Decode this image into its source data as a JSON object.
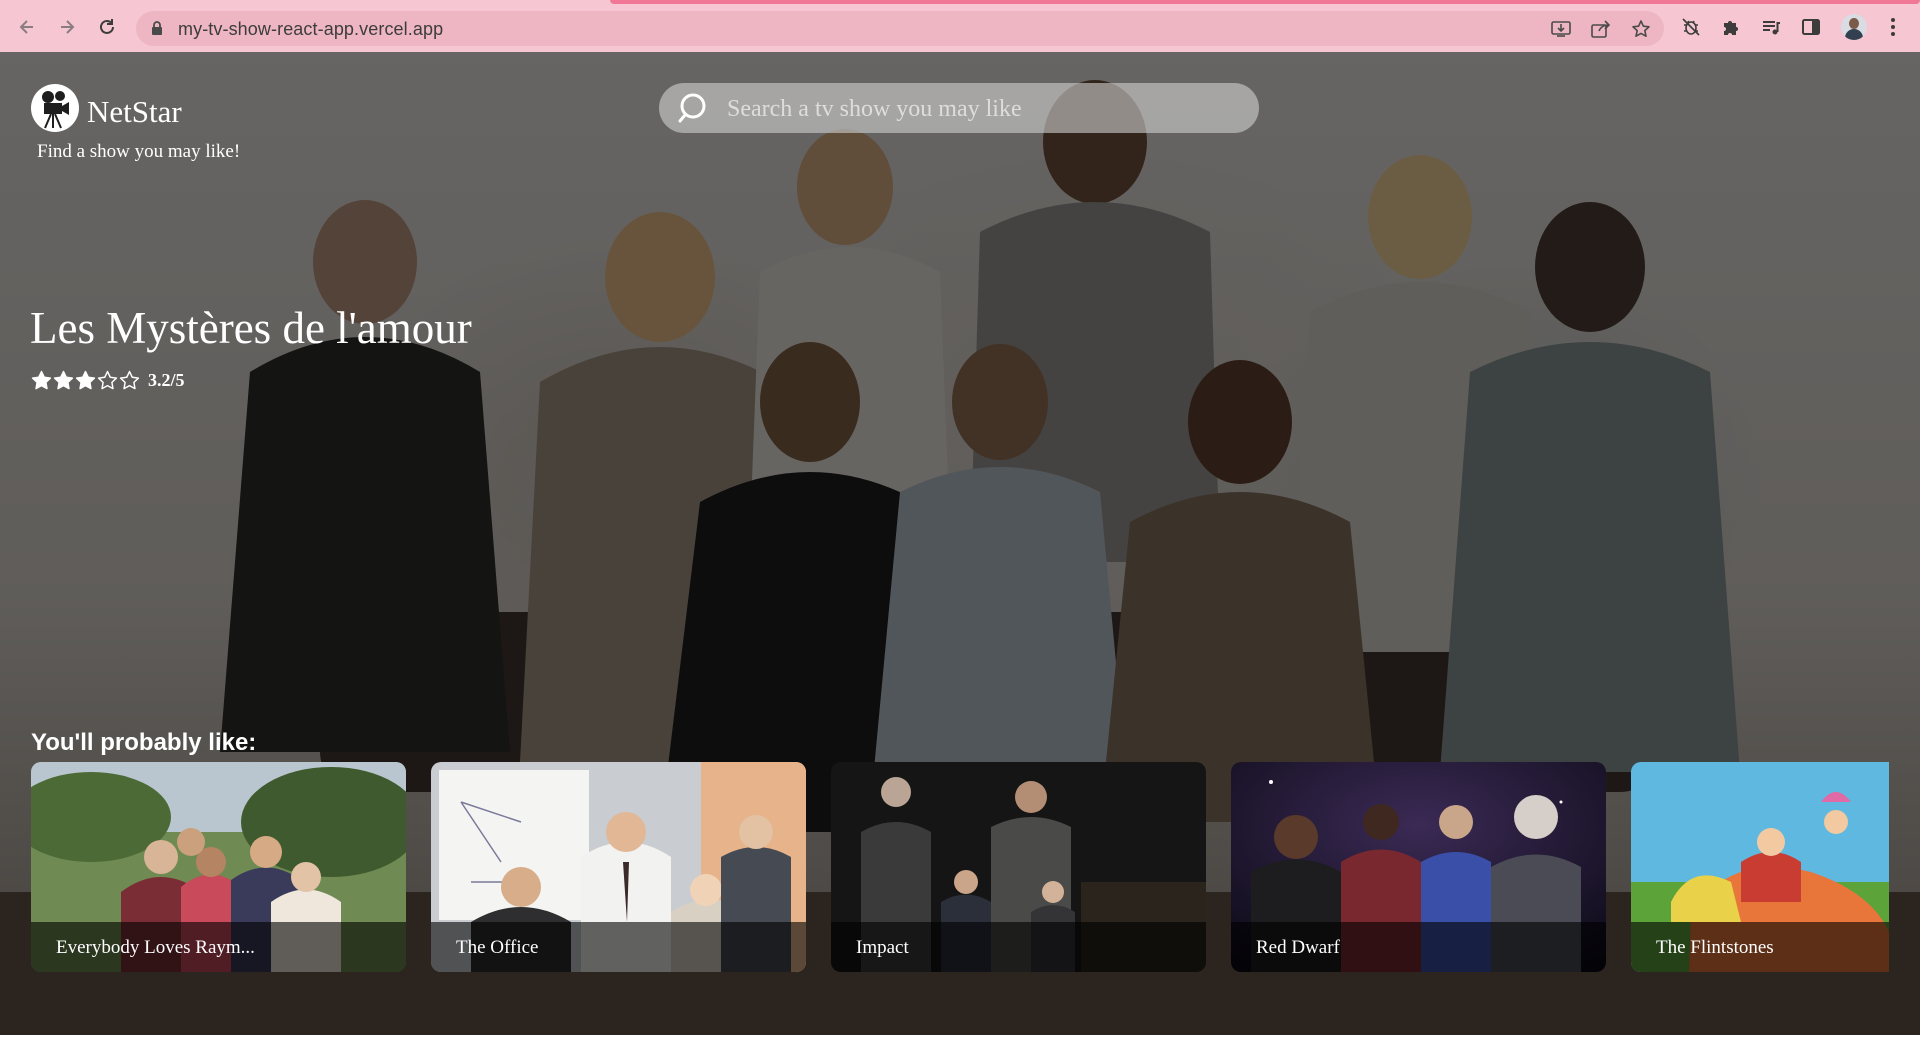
{
  "browser": {
    "url": "my-tv-show-react-app.vercel.app",
    "icons": [
      "back-icon",
      "forward-icon",
      "reload-icon",
      "lock-icon",
      "install-icon",
      "share-icon",
      "bookmark-star-icon",
      "extension-bug-icon",
      "puzzle-icon",
      "media-queue-icon",
      "side-panel-icon",
      "profile-avatar",
      "menu-kebab-icon"
    ]
  },
  "header": {
    "brand": "NetStar",
    "tagline": "Find a show you may like!",
    "logo_icon": "film-camera-icon"
  },
  "search": {
    "placeholder": "Search a tv show you may like",
    "value": ""
  },
  "hero": {
    "title": "Les Mystères de l'amour",
    "rating_text": "3.2/5",
    "stars": {
      "filled": 3,
      "total": 5
    }
  },
  "recommendations": {
    "title": "You'll probably like:",
    "items": [
      {
        "label": "Everybody Loves Raym..."
      },
      {
        "label": "The Office"
      },
      {
        "label": "Impact"
      },
      {
        "label": "Red Dwarf"
      },
      {
        "label": "The Flintstones"
      }
    ]
  },
  "colors": {
    "chrome": "#f6c7d2",
    "accent": "#f07896",
    "text": "#ffffff"
  }
}
